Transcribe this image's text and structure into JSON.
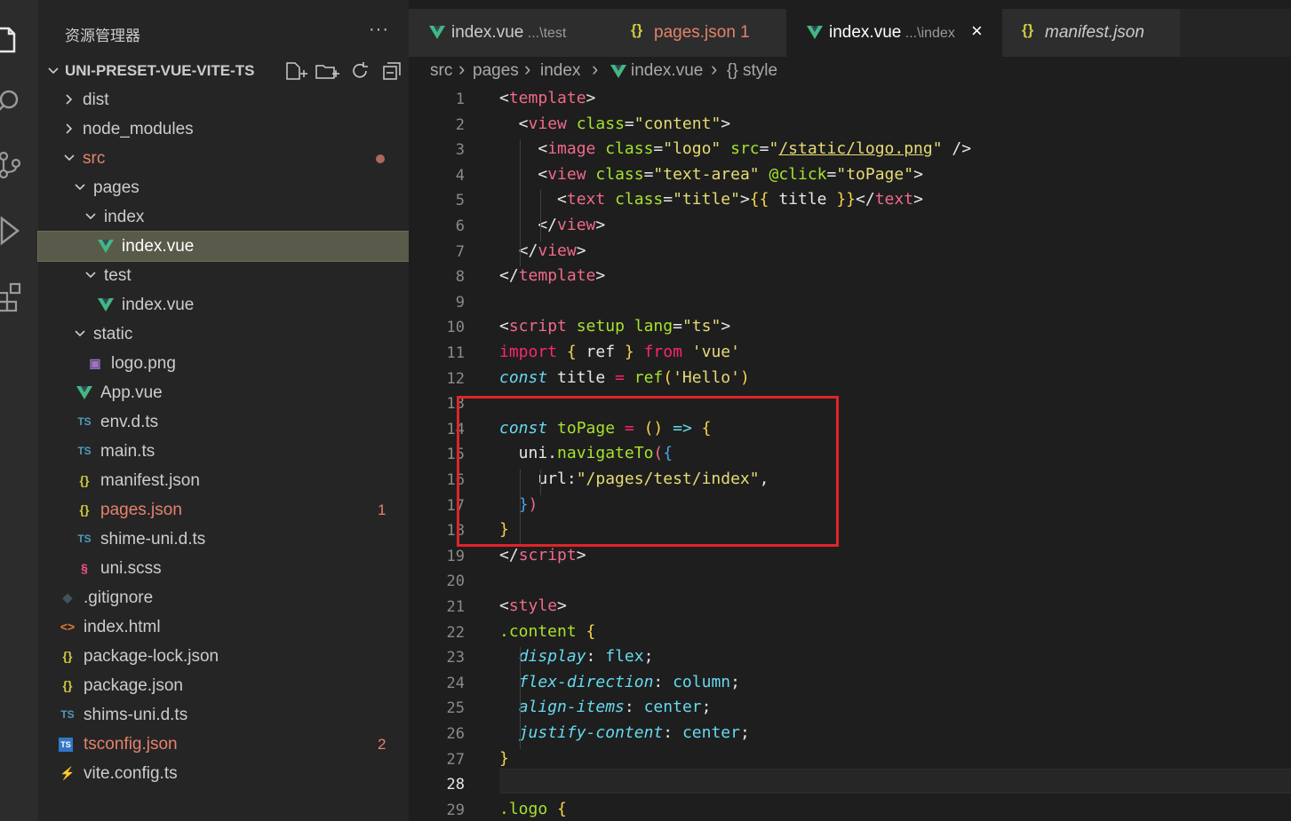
{
  "explorer": {
    "title": "资源管理器",
    "more": "···",
    "project": "UNI-PRESET-VUE-VITE-TS"
  },
  "tree": [
    {
      "label": "dist",
      "depth": 0,
      "kind": "folder",
      "open": false
    },
    {
      "label": "node_modules",
      "depth": 0,
      "kind": "folder",
      "open": false
    },
    {
      "label": "src",
      "depth": 0,
      "kind": "folder",
      "open": true,
      "modified": true,
      "color": "#e5826a"
    },
    {
      "label": "pages",
      "depth": 1,
      "kind": "folder",
      "open": true
    },
    {
      "label": "index",
      "depth": 2,
      "kind": "folder",
      "open": true
    },
    {
      "label": "index.vue",
      "depth": 3,
      "kind": "vue",
      "selected": true
    },
    {
      "label": "test",
      "depth": 2,
      "kind": "folder",
      "open": true
    },
    {
      "label": "index.vue",
      "depth": 3,
      "kind": "vue"
    },
    {
      "label": "static",
      "depth": 1,
      "kind": "folder",
      "open": true
    },
    {
      "label": "logo.png",
      "depth": 2,
      "kind": "image"
    },
    {
      "label": "App.vue",
      "depth": 1,
      "kind": "vue"
    },
    {
      "label": "env.d.ts",
      "depth": 1,
      "kind": "ts"
    },
    {
      "label": "main.ts",
      "depth": 1,
      "kind": "ts"
    },
    {
      "label": "manifest.json",
      "depth": 1,
      "kind": "json"
    },
    {
      "label": "pages.json",
      "depth": 1,
      "kind": "json",
      "badge": "1",
      "color": "#e5826a"
    },
    {
      "label": "shime-uni.d.ts",
      "depth": 1,
      "kind": "ts"
    },
    {
      "label": "uni.scss",
      "depth": 1,
      "kind": "scss"
    },
    {
      "label": ".gitignore",
      "depth": 0,
      "kind": "git"
    },
    {
      "label": "index.html",
      "depth": 0,
      "kind": "html"
    },
    {
      "label": "package-lock.json",
      "depth": 0,
      "kind": "json"
    },
    {
      "label": "package.json",
      "depth": 0,
      "kind": "json"
    },
    {
      "label": "shims-uni.d.ts",
      "depth": 0,
      "kind": "ts"
    },
    {
      "label": "tsconfig.json",
      "depth": 0,
      "kind": "tsconfig",
      "badge": "2",
      "color": "#e5826a"
    },
    {
      "label": "vite.config.ts",
      "depth": 0,
      "kind": "vite"
    }
  ],
  "tabs": [
    {
      "icon": "vue",
      "name": "index.vue",
      "path": "...\\test"
    },
    {
      "icon": "json",
      "name": "pages.json 1",
      "path": "",
      "color": "#e5826a"
    },
    {
      "icon": "vue",
      "name": "index.vue",
      "path": "...\\index",
      "active": true,
      "close": "×"
    },
    {
      "icon": "json",
      "name": "manifest.json",
      "path": "",
      "italic": true
    }
  ],
  "breadcrumb": [
    "src",
    "pages",
    "index",
    "index.vue",
    "{} style"
  ],
  "editor": {
    "current_line": 28,
    "line_numbers": [
      "1",
      "2",
      "3",
      "4",
      "5",
      "6",
      "7",
      "8",
      "9",
      "10",
      "11",
      "12",
      "13",
      "14",
      "15",
      "16",
      "17",
      "18",
      "19",
      "20",
      "21",
      "22",
      "23",
      "24",
      "25",
      "26",
      "27",
      "28",
      "29"
    ],
    "lines": [
      [
        [
          "w",
          "<"
        ],
        [
          "p",
          "template"
        ],
        [
          "w",
          ">"
        ]
      ],
      [
        [
          "w",
          "  <"
        ],
        [
          "p",
          "view"
        ],
        [
          "w",
          " "
        ],
        [
          "g",
          "class"
        ],
        [
          "w",
          "="
        ],
        [
          "y",
          "\"content\""
        ],
        [
          "w",
          ">"
        ]
      ],
      [
        [
          "w",
          "    <"
        ],
        [
          "p",
          "image"
        ],
        [
          "w",
          " "
        ],
        [
          "g",
          "class"
        ],
        [
          "w",
          "="
        ],
        [
          "y",
          "\"logo\""
        ],
        [
          "w",
          " "
        ],
        [
          "g",
          "src"
        ],
        [
          "w",
          "="
        ],
        [
          "y",
          "\""
        ],
        [
          "yu",
          "/static/logo.png"
        ],
        [
          "y",
          "\""
        ],
        [
          "w",
          " />"
        ]
      ],
      [
        [
          "w",
          "    <"
        ],
        [
          "p",
          "view"
        ],
        [
          "w",
          " "
        ],
        [
          "g",
          "class"
        ],
        [
          "w",
          "="
        ],
        [
          "y",
          "\"text-area\""
        ],
        [
          "w",
          " "
        ],
        [
          "g",
          "@click"
        ],
        [
          "w",
          "="
        ],
        [
          "y",
          "\"toPage\""
        ],
        [
          "w",
          ">"
        ]
      ],
      [
        [
          "w",
          "      <"
        ],
        [
          "p",
          "text"
        ],
        [
          "w",
          " "
        ],
        [
          "g",
          "class"
        ],
        [
          "w",
          "="
        ],
        [
          "y",
          "\"title\""
        ],
        [
          "w",
          ">"
        ],
        [
          "o",
          "{{"
        ],
        [
          "w",
          " title "
        ],
        [
          "o",
          "}}"
        ],
        [
          "w",
          "</"
        ],
        [
          "p",
          "text"
        ],
        [
          "w",
          ">"
        ]
      ],
      [
        [
          "w",
          "    </"
        ],
        [
          "p",
          "view"
        ],
        [
          "w",
          ">"
        ]
      ],
      [
        [
          "w",
          "  </"
        ],
        [
          "p",
          "view"
        ],
        [
          "w",
          ">"
        ]
      ],
      [
        [
          "w",
          "</"
        ],
        [
          "p",
          "template"
        ],
        [
          "w",
          ">"
        ]
      ],
      [],
      [
        [
          "w",
          "<"
        ],
        [
          "p",
          "script"
        ],
        [
          "w",
          " "
        ],
        [
          "g",
          "setup"
        ],
        [
          "w",
          " "
        ],
        [
          "g",
          "lang"
        ],
        [
          "w",
          "="
        ],
        [
          "y",
          "\"ts\""
        ],
        [
          "w",
          ">"
        ]
      ],
      [
        [
          "pk",
          "import"
        ],
        [
          "w",
          " "
        ],
        [
          "o",
          "{"
        ],
        [
          "w",
          " ref "
        ],
        [
          "o",
          "}"
        ],
        [
          "w",
          " "
        ],
        [
          "pk",
          "from"
        ],
        [
          "w",
          " "
        ],
        [
          "y",
          "'vue'"
        ]
      ],
      [
        [
          "i",
          "const"
        ],
        [
          "w",
          " title "
        ],
        [
          "pk",
          "="
        ],
        [
          "w",
          " "
        ],
        [
          "g",
          "ref"
        ],
        [
          "o",
          "("
        ],
        [
          "y",
          "'Hello'"
        ],
        [
          "o",
          ")"
        ]
      ],
      [],
      [
        [
          "i",
          "const"
        ],
        [
          "w",
          " "
        ],
        [
          "g",
          "toPage"
        ],
        [
          "w",
          " "
        ],
        [
          "pk",
          "="
        ],
        [
          "w",
          " "
        ],
        [
          "o",
          "()"
        ],
        [
          "w",
          " "
        ],
        [
          "c",
          "=>"
        ],
        [
          "w",
          " "
        ],
        [
          "o",
          "{"
        ]
      ],
      [
        [
          "w",
          "  uni."
        ],
        [
          "g",
          "navigateTo"
        ],
        [
          "p",
          "("
        ],
        [
          "b",
          "{"
        ]
      ],
      [
        [
          "w",
          "    url:"
        ],
        [
          "y",
          "\"/pages/test/index\""
        ],
        [
          "w",
          ","
        ]
      ],
      [
        [
          "w",
          "  "
        ],
        [
          "b",
          "}"
        ],
        [
          "p",
          ")"
        ]
      ],
      [
        [
          "o",
          "}"
        ]
      ],
      [
        [
          "w",
          "</"
        ],
        [
          "p",
          "script"
        ],
        [
          "w",
          ">"
        ]
      ],
      [],
      [
        [
          "w",
          "<"
        ],
        [
          "p",
          "style"
        ],
        [
          "w",
          ">"
        ]
      ],
      [
        [
          "g",
          ".content"
        ],
        [
          "w",
          " "
        ],
        [
          "o",
          "{"
        ]
      ],
      [
        [
          "w",
          "  "
        ],
        [
          "i",
          "display"
        ],
        [
          "w",
          ": "
        ],
        [
          "c",
          "flex"
        ],
        [
          "w",
          ";"
        ]
      ],
      [
        [
          "w",
          "  "
        ],
        [
          "i",
          "flex-direction"
        ],
        [
          "w",
          ": "
        ],
        [
          "c",
          "column"
        ],
        [
          "w",
          ";"
        ]
      ],
      [
        [
          "w",
          "  "
        ],
        [
          "i",
          "align-items"
        ],
        [
          "w",
          ": "
        ],
        [
          "c",
          "center"
        ],
        [
          "w",
          ";"
        ]
      ],
      [
        [
          "w",
          "  "
        ],
        [
          "i",
          "justify-content"
        ],
        [
          "w",
          ": "
        ],
        [
          "c",
          "center"
        ],
        [
          "w",
          ";"
        ]
      ],
      [
        [
          "o",
          "}"
        ]
      ],
      [],
      [
        [
          "g",
          ".logo"
        ],
        [
          "w",
          " "
        ],
        [
          "o",
          "{"
        ]
      ]
    ]
  },
  "colors": {
    "accent_red": "#e0242a",
    "vue_green": "#41b883",
    "modified": "#e5826a",
    "json_yellow": "#cbcb41"
  }
}
